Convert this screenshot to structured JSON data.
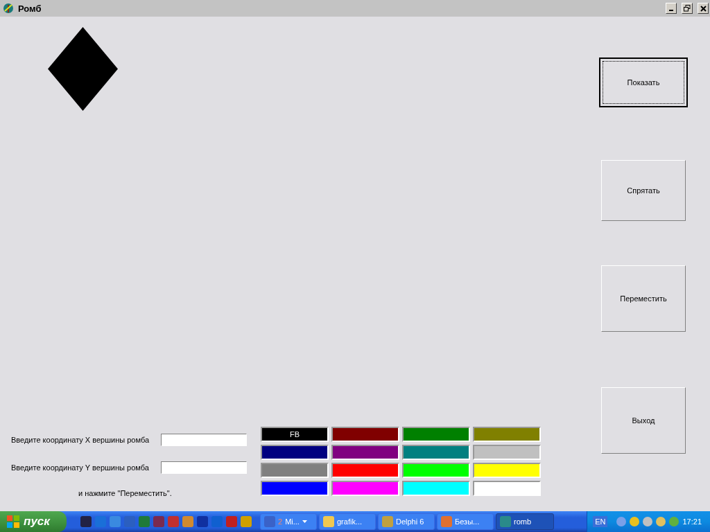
{
  "window": {
    "title": "Ромб"
  },
  "buttons": [
    {
      "label": "Показать",
      "default": true
    },
    {
      "label": "Спрятать",
      "default": false
    },
    {
      "label": "Переместить",
      "default": false
    },
    {
      "label": "Выход",
      "default": false
    }
  ],
  "fields": [
    {
      "label": "Введите координату X вершины ромба"
    },
    {
      "label": "Введите координату Y вершины ромба"
    }
  ],
  "hint": "и нажмите \"Переместить\".",
  "color_grid": [
    {
      "color": "#000000",
      "label": "FB"
    },
    {
      "color": "#800000"
    },
    {
      "color": "#008000"
    },
    {
      "color": "#808000"
    },
    {
      "color": "#000080"
    },
    {
      "color": "#800080"
    },
    {
      "color": "#008080"
    },
    {
      "color": "#c0c0c0"
    },
    {
      "color": "#808080"
    },
    {
      "color": "#ff0000"
    },
    {
      "color": "#00ff00"
    },
    {
      "color": "#ffff00"
    },
    {
      "color": "#0000ff"
    },
    {
      "color": "#ff00ff"
    },
    {
      "color": "#00ffff"
    },
    {
      "color": "#ffffff"
    }
  ],
  "taskbar": {
    "start": "пуск",
    "tasks": [
      {
        "count": "2",
        "label": "Mi...",
        "selected": false,
        "kind": "group"
      },
      {
        "label": "grafik...",
        "selected": false,
        "kind": "folder"
      },
      {
        "label": "Delphi 6",
        "selected": false,
        "kind": "delphi"
      },
      {
        "label": "Безы...",
        "selected": false,
        "kind": "paint"
      },
      {
        "label": "romb",
        "selected": true,
        "kind": "app"
      }
    ],
    "language": "EN",
    "clock": "17:21"
  }
}
